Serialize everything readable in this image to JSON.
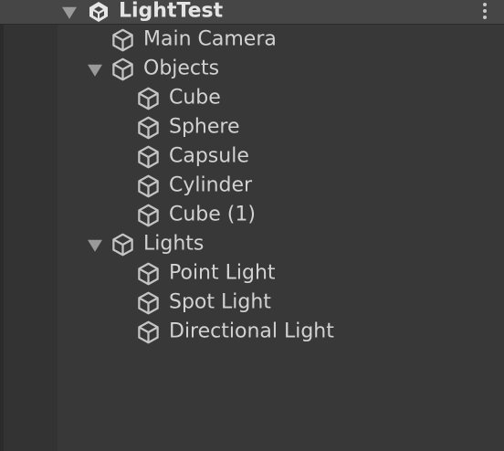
{
  "scene": {
    "name": "LightTest",
    "icon": "unity-scene-icon",
    "menu_icon": "kebab-menu-icon"
  },
  "items": {
    "main_camera": "Main Camera",
    "objects": "Objects",
    "cube": "Cube",
    "sphere": "Sphere",
    "capsule": "Capsule",
    "cylinder": "Cylinder",
    "cube_1": "Cube (1)",
    "lights": "Lights",
    "point_light": "Point Light",
    "spot_light": "Spot Light",
    "directional_light": "Directional Light"
  },
  "icons": {
    "gameobject": "gameobject-cube-icon",
    "fold": "foldout-triangle-icon"
  },
  "colors": {
    "background": "#383838",
    "header": "#464646",
    "text": "#d2d2d2",
    "icon": "#c4c4c4"
  }
}
